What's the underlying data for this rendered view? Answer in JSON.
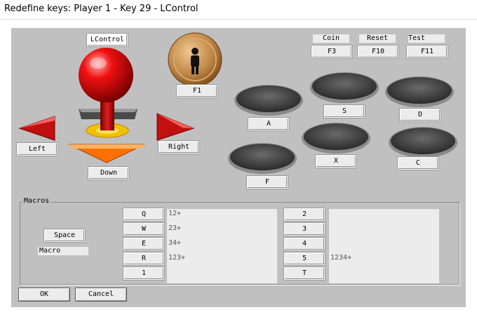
{
  "window": {
    "title": "Redefine keys: Player 1 - Key 29 - LControl"
  },
  "joystick": {
    "button_key": "LControl",
    "left": "Left",
    "right": "Right",
    "down": "Down"
  },
  "start_key": "F1",
  "system": [
    {
      "caption": "Coin",
      "key": "F3"
    },
    {
      "caption": "Reset",
      "key": "F10"
    },
    {
      "caption": "Test",
      "key": "F11"
    }
  ],
  "buttons": {
    "a": "A",
    "s": "S",
    "d": "D",
    "x": "X",
    "c": "C",
    "f": "F"
  },
  "macros": {
    "title": "Macros",
    "trigger_key": "Space",
    "name_label": "Macro",
    "left_keys": [
      "Q",
      "W",
      "E",
      "R",
      "1"
    ],
    "left_values": [
      "12+",
      "23+",
      "34+",
      "123+"
    ],
    "right_keys": [
      "2",
      "3",
      "4",
      "5",
      "T"
    ],
    "right_values": [
      "",
      "",
      "",
      "1234+"
    ]
  },
  "dialog": {
    "ok": "OK",
    "cancel": "Cancel"
  },
  "colors": {
    "client_bg": "#c0c0c0",
    "ball": "#e00000",
    "arrow": "#c01010",
    "button_cap": "#4a4a4a",
    "start_button": "#b07840"
  }
}
